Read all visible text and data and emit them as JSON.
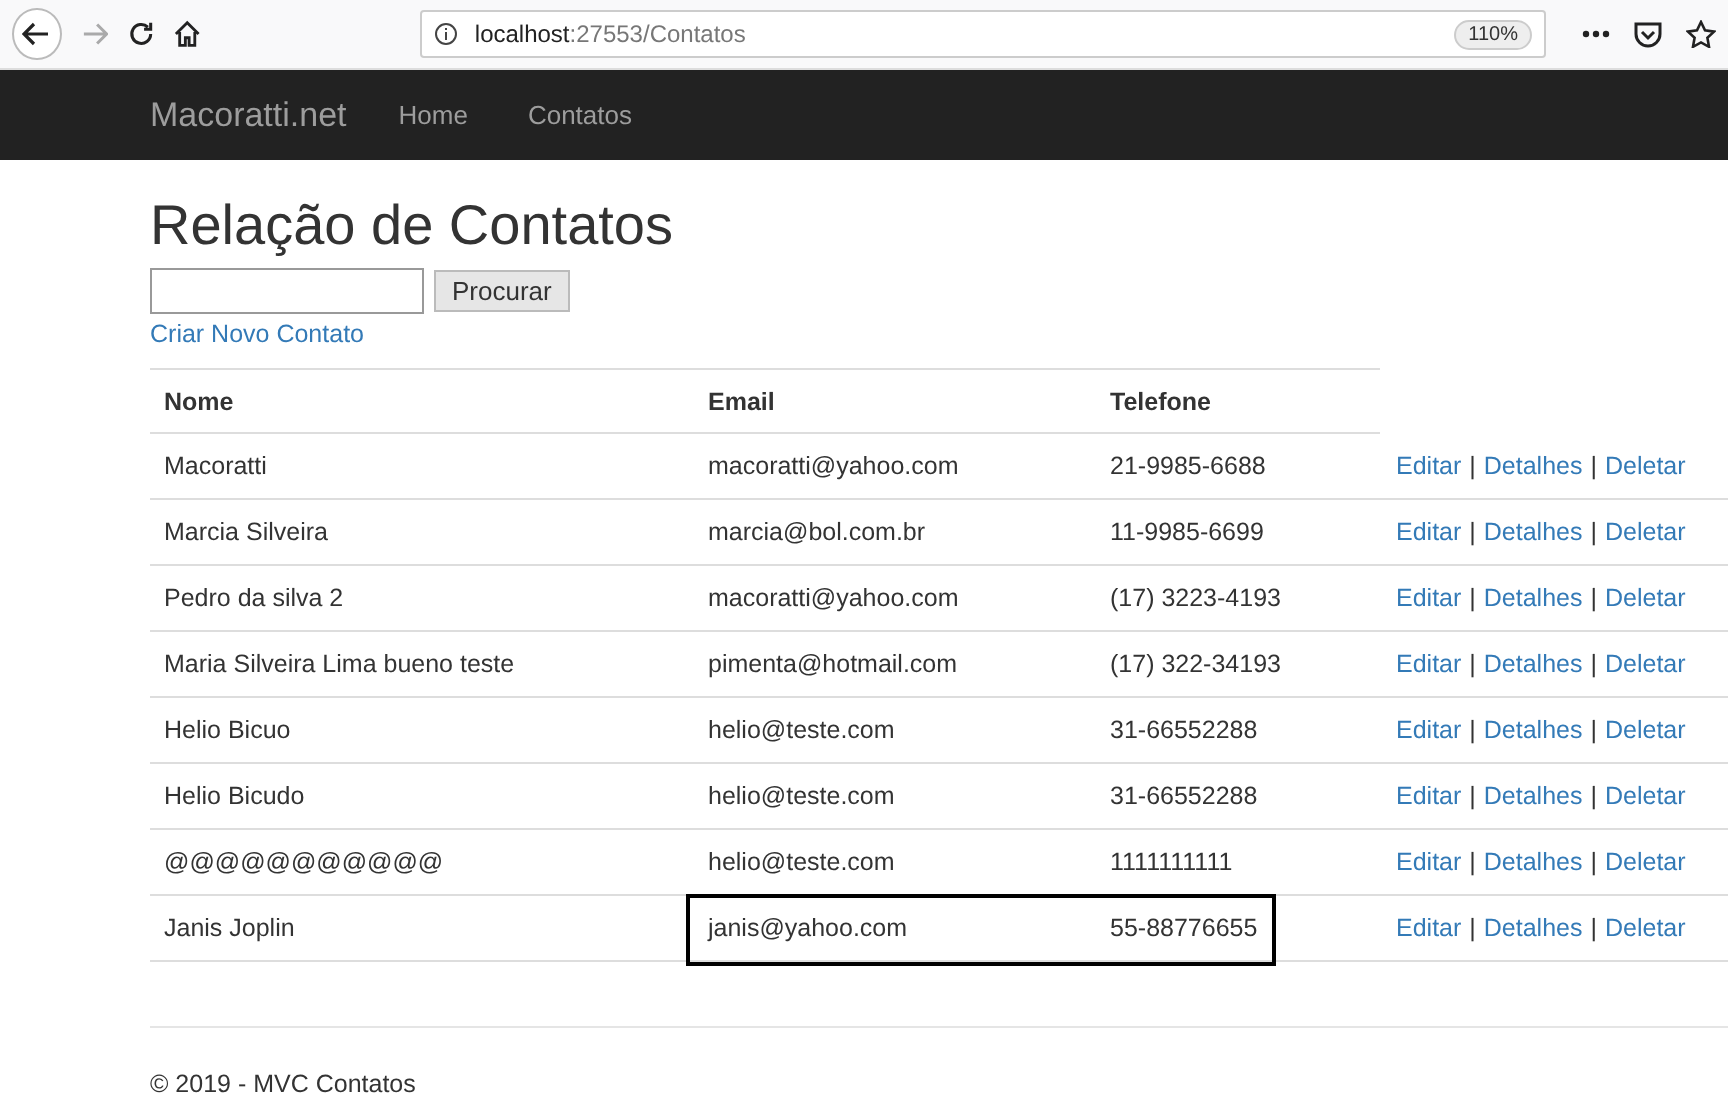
{
  "browser": {
    "url_host": "localhost",
    "url_path": ":27553/Contatos",
    "zoom": "110%"
  },
  "navbar": {
    "brand": "Macoratti.net",
    "links": [
      "Home",
      "Contatos"
    ]
  },
  "page": {
    "title": "Relação de Contatos",
    "search": {
      "button": "Procurar"
    },
    "create_link": "Criar Novo Contato"
  },
  "table": {
    "columns": [
      "Nome",
      "Email",
      "Telefone"
    ],
    "separator": "|",
    "rows": [
      {
        "nome": "Macoratti",
        "email": "macoratti@yahoo.com",
        "telefone": "21-9985-6688",
        "actions": [
          "Editar",
          "Detalhes",
          "Deletar"
        ],
        "highlighted": false
      },
      {
        "nome": "Marcia Silveira",
        "email": "marcia@bol.com.br",
        "telefone": "11-9985-6699",
        "actions": [
          "Editar",
          "Detalhes",
          "Deletar"
        ],
        "highlighted": false
      },
      {
        "nome": "Pedro da silva 2",
        "email": "macoratti@yahoo.com",
        "telefone": "(17) 3223-4193",
        "actions": [
          "Editar",
          "Detalhes",
          "Deletar"
        ],
        "highlighted": false
      },
      {
        "nome": "Maria Silveira Lima bueno teste",
        "email": "pimenta@hotmail.com",
        "telefone": "(17) 322-34193",
        "actions": [
          "Editar",
          "Detalhes",
          "Deletar"
        ],
        "highlighted": false
      },
      {
        "nome": "Helio Bicuo",
        "email": "helio@teste.com",
        "telefone": "31-66552288",
        "actions": [
          "Editar",
          "Detalhes",
          "Deletar"
        ],
        "highlighted": false
      },
      {
        "nome": "Helio Bicudo",
        "email": "helio@teste.com",
        "telefone": "31-66552288",
        "actions": [
          "Editar",
          "Detalhes",
          "Deletar"
        ],
        "highlighted": false
      },
      {
        "nome": "@@@@@@@@@@@",
        "email": "helio@teste.com",
        "telefone": "1111111111",
        "actions": [
          "Editar",
          "Detalhes",
          "Deletar"
        ],
        "highlighted": false
      },
      {
        "nome": "Janis Joplin",
        "email": "janis@yahoo.com",
        "telefone": "55-88776655",
        "actions": [
          "Editar",
          "Detalhes",
          "Deletar"
        ],
        "highlighted": true
      }
    ]
  },
  "footer": "© 2019 - MVC Contatos"
}
